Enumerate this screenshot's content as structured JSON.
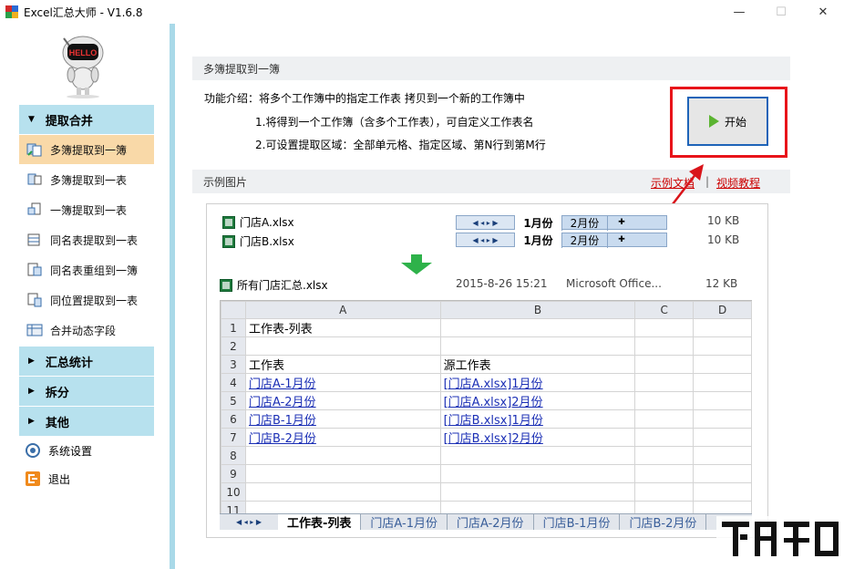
{
  "window": {
    "title": "Excel汇总大师 - V1.6.8",
    "minimize": "—",
    "maximize": "☐",
    "close": "✕"
  },
  "sidebar": {
    "sections": [
      {
        "label": "提取合并",
        "expanded": true
      },
      {
        "label": "汇总统计",
        "expanded": false
      },
      {
        "label": "拆分",
        "expanded": false
      },
      {
        "label": "其他",
        "expanded": false
      }
    ],
    "items": [
      {
        "label": "多簿提取到一簿",
        "icon": "multi-book-to-book-icon"
      },
      {
        "label": "多簿提取到一表",
        "icon": "multi-book-to-sheet-icon"
      },
      {
        "label": "一簿提取到一表",
        "icon": "book-to-sheet-icon"
      },
      {
        "label": "同名表提取到一表",
        "icon": "same-name-sheet-icon"
      },
      {
        "label": "同名表重组到一簿",
        "icon": "regroup-sheet-icon"
      },
      {
        "label": "同位置提取到一表",
        "icon": "same-position-icon"
      },
      {
        "label": "合并动态字段",
        "icon": "dynamic-field-icon"
      }
    ],
    "settings": "系统设置",
    "exit": "退出"
  },
  "main": {
    "header": "多簿提取到一簿",
    "intro": "功能介绍：将多个工作簿中的指定工作表 拷贝到一个新的工作簿中",
    "point1": "1.将得到一个工作簿（含多个工作表），可自定义工作表名",
    "point2": "2.可设置提取区域：全部单元格、指定区域、第N行到第M行",
    "start_button": "开始",
    "example_header": "示例图片",
    "link_sample": "示例文档",
    "link_sep": "|",
    "link_video": "视频教程"
  },
  "example": {
    "files": [
      {
        "name": "门店A.xlsx",
        "tab1": "1月份",
        "tab2": "2月份",
        "size": "10 KB"
      },
      {
        "name": "门店B.xlsx",
        "tab1": "1月份",
        "tab2": "2月份",
        "size": "10 KB"
      }
    ],
    "result": {
      "name": "所有门店汇总.xlsx",
      "date": "2015-8-26 15:21",
      "type": "Microsoft Office...",
      "size": "12 KB"
    },
    "columns": [
      "A",
      "B",
      "C",
      "D"
    ],
    "rows": [
      {
        "n": "1",
        "a": "工作表-列表",
        "b": "",
        "a_link": false,
        "b_link": false
      },
      {
        "n": "2",
        "a": "",
        "b": "",
        "a_link": false,
        "b_link": false
      },
      {
        "n": "3",
        "a": "工作表",
        "b": "源工作表",
        "a_link": false,
        "b_link": false
      },
      {
        "n": "4",
        "a": "门店A-1月份",
        "b": "[门店A.xlsx]1月份",
        "a_link": true,
        "b_link": true
      },
      {
        "n": "5",
        "a": "门店A-2月份",
        "b": "[门店A.xlsx]2月份",
        "a_link": true,
        "b_link": true
      },
      {
        "n": "6",
        "a": "门店B-1月份",
        "b": "[门店B.xlsx]1月份",
        "a_link": true,
        "b_link": true
      },
      {
        "n": "7",
        "a": "门店B-2月份",
        "b": "[门店B.xlsx]2月份",
        "a_link": true,
        "b_link": true
      },
      {
        "n": "8",
        "a": "",
        "b": "",
        "a_link": false,
        "b_link": false
      },
      {
        "n": "9",
        "a": "",
        "b": "",
        "a_link": false,
        "b_link": false
      },
      {
        "n": "10",
        "a": "",
        "b": "",
        "a_link": false,
        "b_link": false
      },
      {
        "n": "11",
        "a": "",
        "b": "",
        "a_link": false,
        "b_link": false
      }
    ],
    "sheet_tabs": [
      "工作表-列表",
      "门店A-1月份",
      "门店A-2月份",
      "门店B-1月份",
      "门店B-2月份"
    ]
  },
  "colors": {
    "accent_border": "#e8141a",
    "sidebar_header": "#b7e1ee",
    "active_item": "#f9d9a8",
    "button_border": "#1e63b8"
  }
}
